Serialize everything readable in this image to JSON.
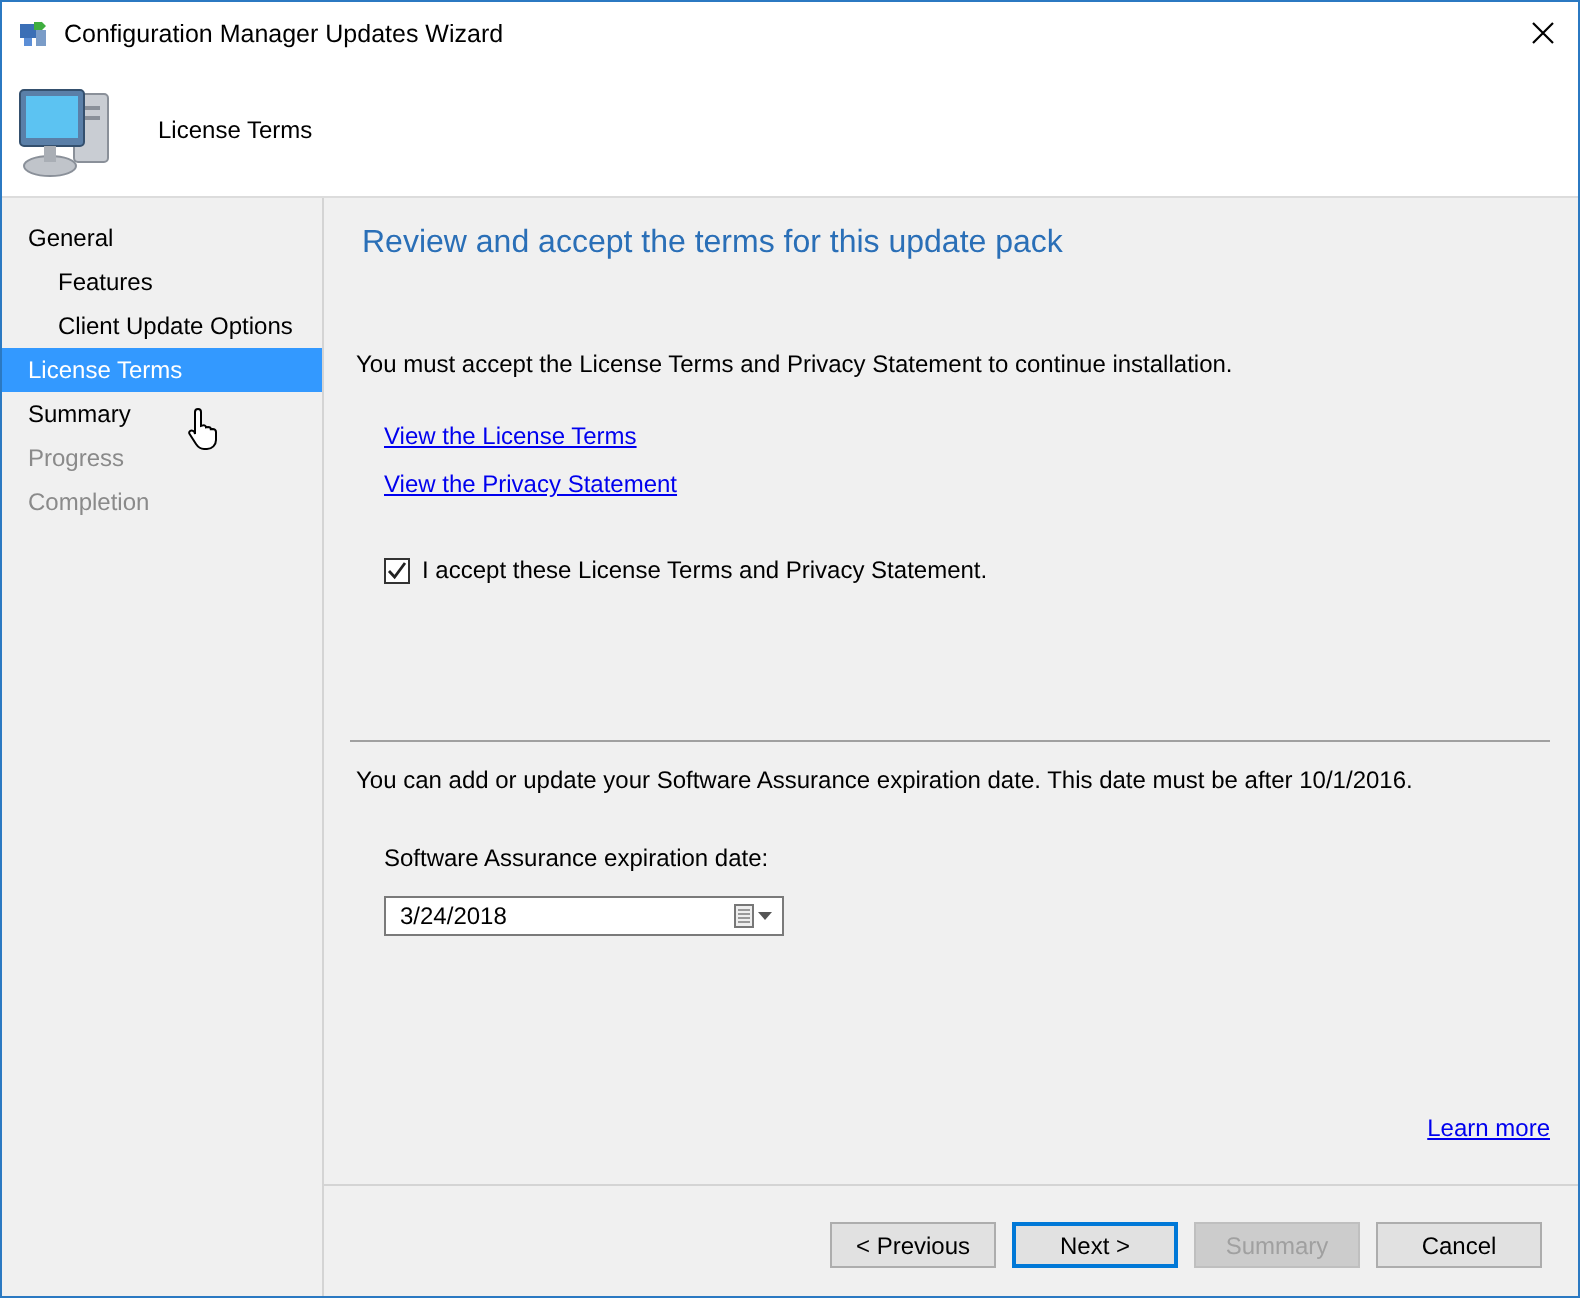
{
  "window": {
    "title": "Configuration Manager Updates Wizard"
  },
  "header": {
    "title": "License Terms"
  },
  "sidebar": {
    "items": [
      {
        "label": "General",
        "selected": false,
        "disabled": false,
        "children": [
          {
            "label": "Features",
            "selected": false,
            "disabled": false
          },
          {
            "label": "Client Update Options",
            "selected": false,
            "disabled": false
          }
        ]
      },
      {
        "label": "License Terms",
        "selected": true,
        "disabled": false
      },
      {
        "label": "Summary",
        "selected": false,
        "disabled": false
      },
      {
        "label": "Progress",
        "selected": false,
        "disabled": true
      },
      {
        "label": "Completion",
        "selected": false,
        "disabled": true
      }
    ]
  },
  "page": {
    "heading": "Review and accept the terms for this update pack",
    "intro": "You must accept the License Terms and Privacy Statement to continue installation.",
    "links": [
      "View the License Terms",
      "View the Privacy Statement"
    ],
    "accept": {
      "label": "I accept these License Terms and Privacy Statement.",
      "checked": true
    },
    "assurance_note": "You can add or update your Software Assurance expiration date. This date must be after 10/1/2016.",
    "date_label": "Software Assurance expiration date:",
    "date_value": "3/24/2018",
    "learn_more": "Learn more"
  },
  "buttons": [
    {
      "label": "< Previous",
      "default": false,
      "disabled": false
    },
    {
      "label": "Next >",
      "default": true,
      "disabled": false
    },
    {
      "label": "Summary",
      "default": false,
      "disabled": true
    },
    {
      "label": "Cancel",
      "default": false,
      "disabled": false
    }
  ]
}
